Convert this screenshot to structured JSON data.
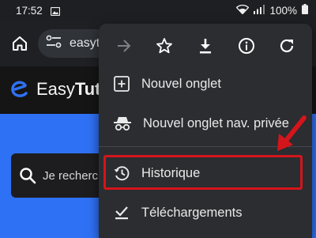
{
  "status_bar": {
    "time": "17:52",
    "battery": "100%"
  },
  "toolbar": {
    "url_text": "easytu"
  },
  "site": {
    "name_regular": "Easy",
    "name_bold": "Tut",
    "search_placeholder": "Je recherc"
  },
  "menu": {
    "items": [
      {
        "label": "Nouvel onglet",
        "icon": "new-tab-icon"
      },
      {
        "label": "Nouvel onglet nav. privée",
        "icon": "incognito-icon"
      },
      {
        "label": "Historique",
        "icon": "history-icon"
      },
      {
        "label": "Téléchargements",
        "icon": "downloads-icon"
      }
    ]
  },
  "colors": {
    "hero": "#2f71f5",
    "menu_bg": "#2b2d31",
    "highlight": "#d4151b"
  }
}
